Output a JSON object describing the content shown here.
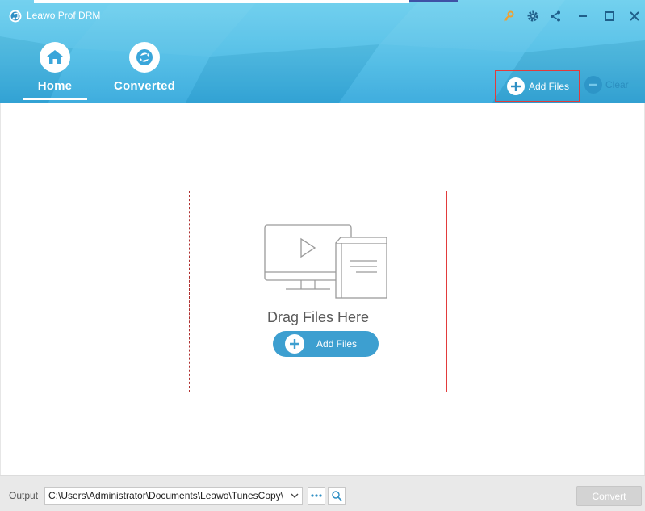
{
  "window": {
    "title": "Leawo Prof DRM"
  },
  "titlebar": {
    "icons": [
      "key-icon",
      "gear-icon",
      "share-icon",
      "minimize-icon",
      "maximize-icon",
      "close-icon"
    ]
  },
  "nav": {
    "tabs": [
      {
        "label": "Home",
        "icon": "home-icon",
        "active": true
      },
      {
        "label": "Converted",
        "icon": "refresh-icon",
        "active": false
      }
    ]
  },
  "toolbar": {
    "add_files_label": "Add Files",
    "clear_label": "Clear"
  },
  "dropzone": {
    "text": "Drag Files Here",
    "add_files_label": "Add Files"
  },
  "footer": {
    "output_label": "Output",
    "output_path": "C:\\Users\\Administrator\\Documents\\Leawo\\TunesCopy\\",
    "convert_label": "Convert"
  },
  "colors": {
    "header": "#4fbde6",
    "accent": "#3d9fd0",
    "highlight_border": "#e23b3b",
    "key_icon": "#f0a030"
  }
}
